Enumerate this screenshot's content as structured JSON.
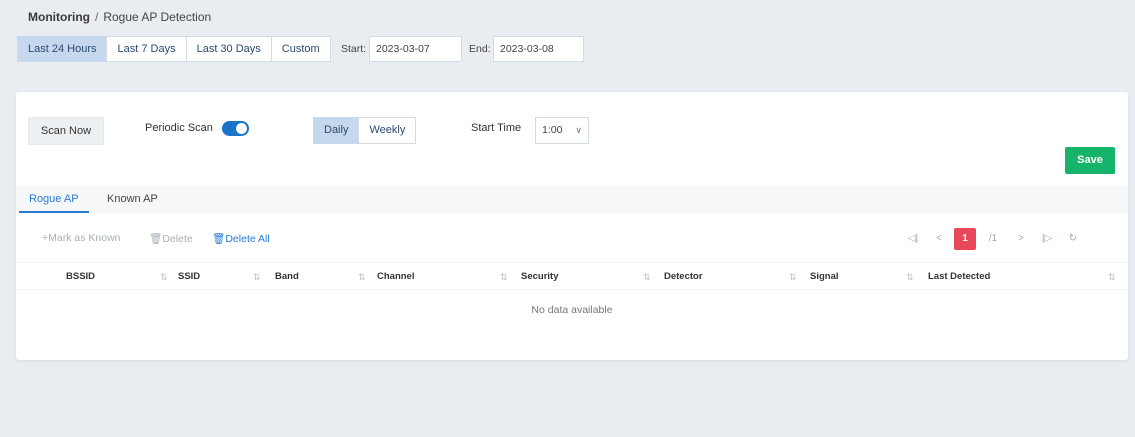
{
  "breadcrumb": {
    "section": "Monitoring",
    "separator": "/",
    "page": "Rogue AP Detection"
  },
  "date_range": {
    "options": [
      "Last 24 Hours",
      "Last 7 Days",
      "Last 30 Days",
      "Custom"
    ],
    "selected": "Last 24 Hours",
    "start_label": "Start:",
    "start_value": "2023-03-07",
    "end_label": "End:",
    "end_value": "2023-03-08"
  },
  "scan": {
    "scan_now_label": "Scan Now",
    "periodic_label": "Periodic Scan",
    "periodic_enabled": true,
    "frequency_options": [
      "Daily",
      "Weekly"
    ],
    "frequency_selected": "Daily",
    "start_time_label": "Start Time",
    "start_time_value": "1:00",
    "save_label": "Save"
  },
  "tabs": [
    "Rogue AP",
    "Known AP"
  ],
  "active_tab": "Rogue AP",
  "toolbar": {
    "mark_known": "Mark as Known",
    "delete": "Delete",
    "delete_all": "Delete All"
  },
  "pagination": {
    "current": "1",
    "total": "/1"
  },
  "table": {
    "columns": [
      "BSSID",
      "SSID",
      "Band",
      "Channel",
      "Security",
      "Detector",
      "Signal",
      "Last Detected"
    ],
    "rows": [],
    "empty_text": "No data available"
  },
  "colors": {
    "accent": "#2a7ad4",
    "save": "#16b36b",
    "page_current": "#e8485a",
    "toggle_on": "#1a73c8"
  }
}
